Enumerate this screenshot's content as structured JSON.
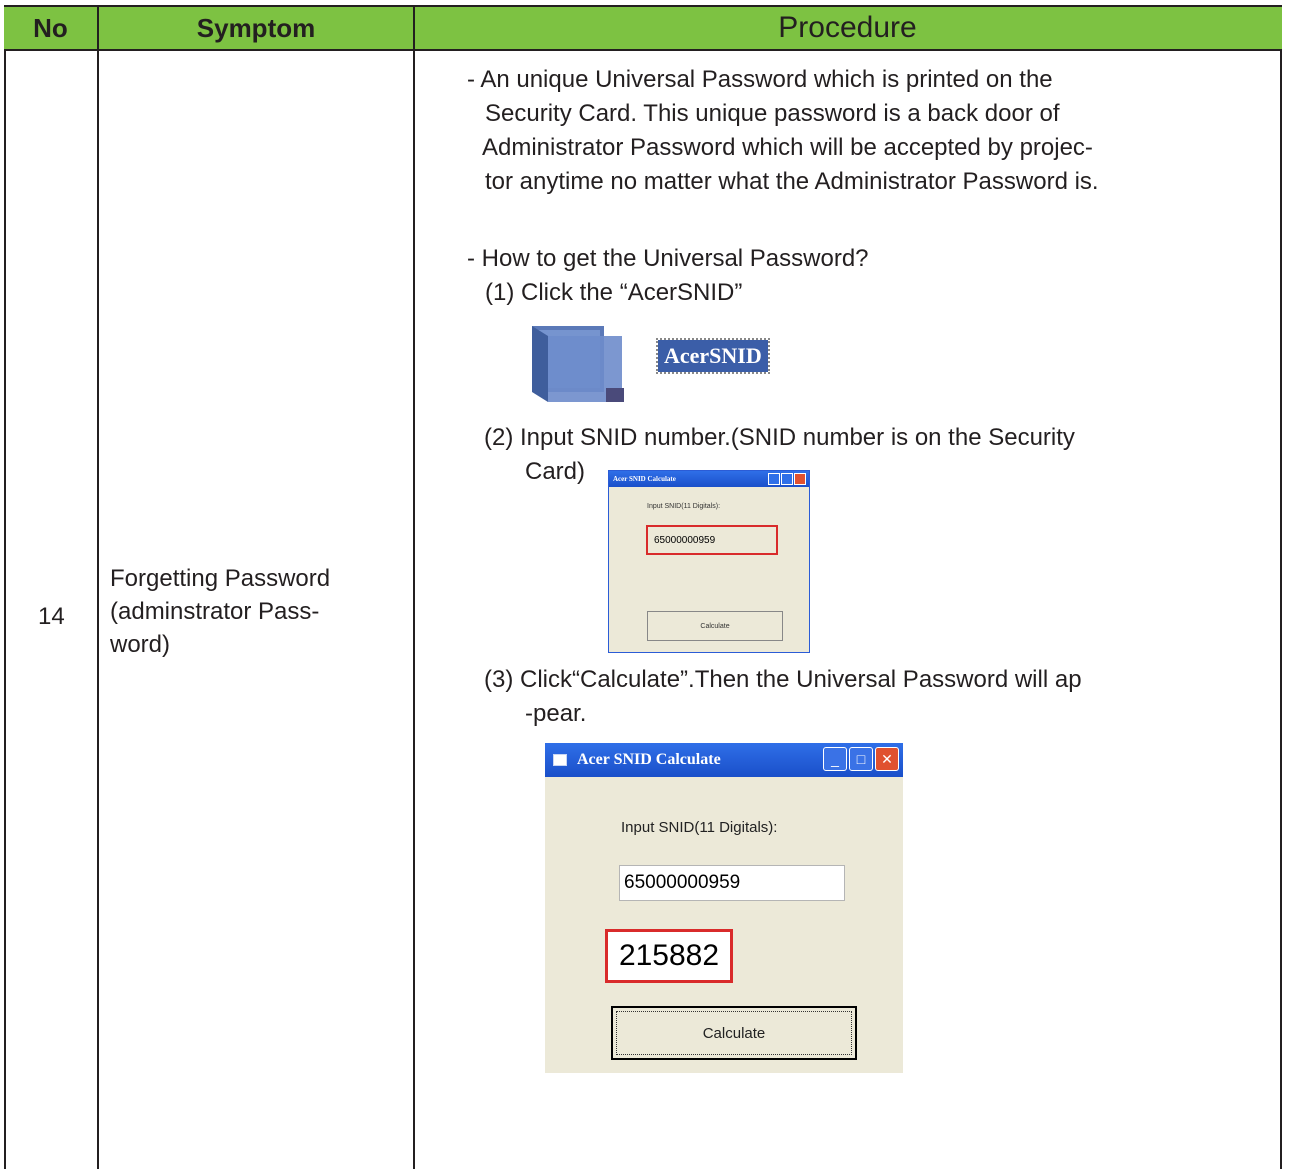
{
  "header": {
    "no": "No",
    "symptom": "Symptom",
    "procedure": "Procedure"
  },
  "row": {
    "no": "14",
    "symptom_lines": [
      "Forgetting Password",
      "(adminstrator Pass-",
      "word)"
    ],
    "procedure": {
      "intro_lines": [
        "- An unique Universal Password which is printed on the",
        "Security Card. This unique password is a back door of",
        "Administrator Password which will be accepted by projec-",
        "tor anytime no matter what the Administrator Password is."
      ],
      "how_to": "- How to get the Universal Password?",
      "step1": "(1) Click the “AcerSNID”",
      "step1_icon_label": "AcerSNID",
      "step2_lines": [
        "(2) Input SNID number.(SNID number is on the Security",
        "Card)"
      ],
      "step3_lines": [
        "(3) Click“Calculate”.Then the Universal Password will ap",
        "-pear."
      ]
    }
  },
  "window_small": {
    "title": "Acer SNID Calculate",
    "label": "Input SNID(11 Digitals):",
    "input_value": "65000000959",
    "button": "Calculate"
  },
  "window_large": {
    "title": "Acer SNID Calculate",
    "label": "Input SNID(11 Digitals):",
    "input_value": "65000000959",
    "result": "215882",
    "button": "Calculate",
    "minimize_glyph": "_",
    "maximize_glyph": "□",
    "close_glyph": "✕"
  },
  "colors": {
    "header_bg": "#7dc242",
    "highlight_border": "#d92b2b",
    "titlebar": "#1a4fc9"
  }
}
